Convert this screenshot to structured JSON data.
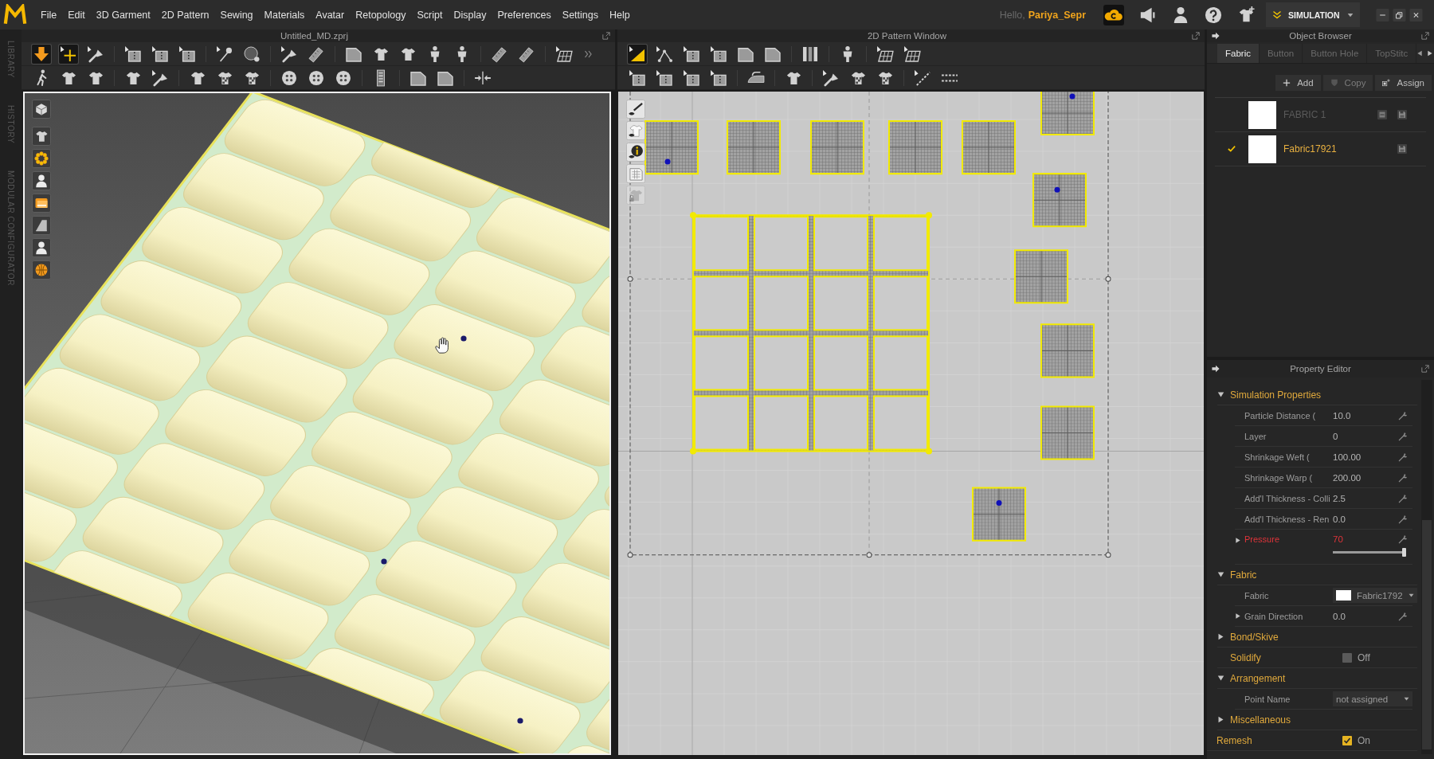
{
  "menu_bar": {
    "items": [
      "File",
      "Edit",
      "3D Garment",
      "2D Pattern",
      "Sewing",
      "Materials",
      "Avatar",
      "Retopology",
      "Script",
      "Display",
      "Preferences",
      "Settings",
      "Help"
    ],
    "greeting": "Hello,",
    "user_name": "Pariya_Sepr",
    "mode_button": "SIMULATION"
  },
  "side_tabs": [
    "LIBRARY",
    "HISTORY",
    "MODULAR CONFIGURATOR"
  ],
  "garment_window": {
    "title": "Untitled_MD.zprj",
    "toolbar_rows": [
      [
        {
          "selected": true
        },
        {
          "selected": true
        },
        {
          "selected": false
        },
        {
          "selected": false
        },
        {
          "selected": false
        },
        {
          "selected": false
        },
        {
          "selected": false
        },
        {
          "selected": false
        },
        {
          "selected": false
        },
        {
          "selected": false
        },
        {
          "selected": false
        },
        {
          "selected": false
        },
        {
          "selected": false
        },
        {
          "selected": false
        },
        {
          "selected": false
        },
        {
          "selected": false
        },
        {
          "selected": false
        },
        {
          "selected": false
        }
      ],
      [
        {
          "selected": false
        },
        {
          "selected": false
        },
        {
          "selected": false
        },
        {
          "selected": false
        },
        {
          "selected": false
        },
        {
          "selected": false
        },
        {
          "selected": false
        },
        {
          "selected": false
        },
        {
          "selected": false
        },
        {
          "selected": false
        },
        {
          "selected": false
        },
        {
          "selected": false
        },
        {
          "selected": false
        },
        {
          "selected": false
        },
        {
          "selected": false
        }
      ]
    ]
  },
  "pattern_window": {
    "title": "2D Pattern Window",
    "toolbar_rows": [
      [
        {
          "selected": true
        },
        {
          "selected": false
        },
        {
          "selected": false
        },
        {
          "selected": false
        },
        {
          "selected": false
        },
        {
          "selected": false
        },
        {
          "selected": false
        },
        {
          "selected": false
        },
        {
          "selected": false
        },
        {
          "selected": false
        }
      ],
      [
        {
          "selected": false
        },
        {
          "selected": false
        },
        {
          "selected": false
        },
        {
          "selected": false
        },
        {
          "selected": false
        },
        {
          "selected": false
        },
        {
          "selected": false
        },
        {
          "selected": false
        },
        {
          "selected": false
        },
        {
          "selected": false
        },
        {
          "selected": false
        }
      ]
    ],
    "canvas_tools": [
      {
        "disabled": false
      },
      {
        "disabled": false
      },
      {
        "disabled": false
      },
      {
        "disabled": false
      },
      {
        "disabled": true
      }
    ]
  },
  "object_browser": {
    "title": "Object Browser",
    "tabs": [
      {
        "label": "Fabric",
        "selected": true
      },
      {
        "label": "Button",
        "selected": false
      },
      {
        "label": "Button Hole",
        "selected": false
      },
      {
        "label": "TopStitc",
        "selected": false
      }
    ],
    "actions": [
      {
        "label": "Add",
        "disabled": false
      },
      {
        "label": "Copy",
        "disabled": true
      },
      {
        "label": "Assign",
        "disabled": false
      }
    ],
    "fabrics": [
      {
        "name": "FABRIC 1",
        "selected": false,
        "removable": true
      },
      {
        "name": "Fabric17921",
        "selected": true,
        "removable": false
      }
    ]
  },
  "property_editor": {
    "title": "Property Editor",
    "groups": [
      {
        "kind": "group",
        "label": "Simulation Properties",
        "expanded": true,
        "rows": [
          {
            "kind": "value",
            "label": "Particle Distance (",
            "value": "10.0"
          },
          {
            "kind": "value",
            "label": "Layer",
            "value": "0"
          },
          {
            "kind": "value",
            "label": "Shrinkage Weft (",
            "value": "100.00"
          },
          {
            "kind": "value",
            "label": "Shrinkage Warp (",
            "value": "200.00"
          },
          {
            "kind": "value",
            "label": "Add'l Thickness - Colli",
            "value": "2.5"
          },
          {
            "kind": "value",
            "label": "Add'l Thickness - Ren",
            "value": "0.0"
          },
          {
            "kind": "slider",
            "label": "Pressure",
            "value": "70",
            "level": 1.0,
            "expanded": false,
            "color": "#e0343a"
          }
        ]
      },
      {
        "kind": "group",
        "label": "Fabric",
        "expanded": true,
        "rows": [
          {
            "kind": "dropdown",
            "label": "Fabric",
            "value": "Fabric1792",
            "color": "#ffffff"
          },
          {
            "kind": "value",
            "label": "Grain Direction",
            "value": "0.0",
            "expanded": false
          }
        ]
      },
      {
        "kind": "group",
        "label": "Bond/Skive",
        "expanded": false
      },
      {
        "kind": "toggle",
        "label": "Solidify",
        "checked": false,
        "state_text": "Off"
      },
      {
        "kind": "group",
        "label": "Arrangement",
        "expanded": true,
        "rows": [
          {
            "kind": "dropdown",
            "label": "Point Name",
            "value": "not assigned"
          }
        ]
      },
      {
        "kind": "group",
        "label": "Miscellaneous",
        "expanded": false
      }
    ],
    "remesh": {
      "label": "Remesh",
      "checked": true,
      "state_text": "On"
    }
  }
}
